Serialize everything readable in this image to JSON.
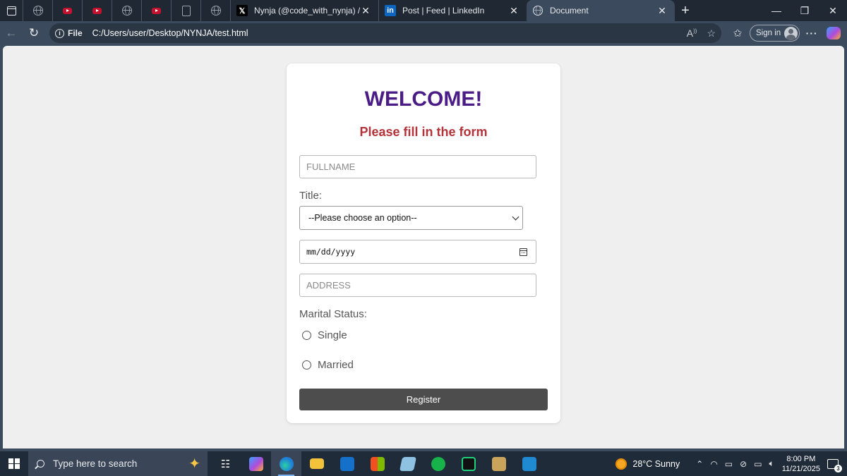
{
  "browser": {
    "tabs": [
      {
        "title": "Nynja (@code_with_nynja) / X",
        "favicon": "x-logo-icon"
      },
      {
        "title": "Post | Feed | LinkedIn",
        "favicon": "linkedin-logo-icon"
      },
      {
        "title": "Document",
        "favicon": "globe-icon",
        "active": true
      }
    ],
    "pinned_tabs": [
      "globe-icon",
      "youtube-icon",
      "youtube-icon",
      "globe-icon",
      "youtube-icon",
      "document-icon",
      "globe-icon"
    ],
    "address": {
      "scheme_label": "File",
      "url": "C:/Users/user/Desktop/NYNJA/test.html"
    },
    "sign_in_label": "Sign in"
  },
  "page": {
    "heading": "WELCOME!",
    "subheading": "Please fill in the form",
    "fullname_placeholder": "FULLNAME",
    "title_label": "Title:",
    "title_select_value": "--Please choose an option--",
    "date_placeholder": "mm/dd/yyyy",
    "address_placeholder": "ADDRESS",
    "marital_label": "Marital Status:",
    "marital_options": [
      "Single",
      "Married"
    ],
    "register_label": "Register",
    "colors": {
      "heading": "#4b1c86",
      "subheading": "#b3333a",
      "button": "#4d4d4d"
    }
  },
  "taskbar": {
    "search_placeholder": "Type here to search",
    "weather": "28°C  Sunny",
    "time": "8:00 PM",
    "date": "11/21/2025",
    "notification_count": "3"
  }
}
